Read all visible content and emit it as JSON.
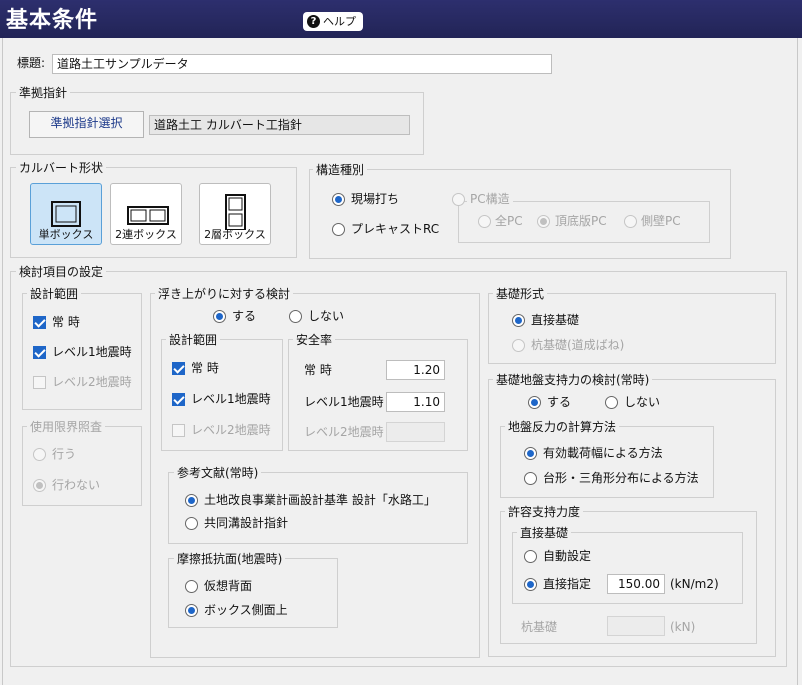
{
  "header": {
    "title": "基本条件",
    "help_label": "ヘルプ"
  },
  "title_field": {
    "label": "標題:",
    "value": "道路土工サンプルデータ"
  },
  "standard": {
    "legend": "準拠指針",
    "button_label": "準拠指針選択",
    "value": "道路土工 カルバート工指針"
  },
  "culvert_shape": {
    "legend": "カルバート形状",
    "options": [
      {
        "label": "単ボックス",
        "selected": true
      },
      {
        "label": "2連ボックス",
        "selected": false
      },
      {
        "label": "2層ボックス",
        "selected": false
      }
    ]
  },
  "structure_type": {
    "legend": "構造種別",
    "cast_in_place": "現場打ち",
    "precast": "プレキャストRC",
    "pc_legend": "PC構造",
    "pc_options": [
      "全PC",
      "頂底版PC",
      "側壁PC"
    ]
  },
  "check_items": {
    "legend": "検討項目の設定",
    "design_range": {
      "legend": "設計範囲",
      "items": [
        "常 時",
        "レベル1地震時",
        "レベル2地震時"
      ]
    },
    "service_limit": {
      "legend": "使用限界照査",
      "yes": "行う",
      "no": "行わない"
    }
  },
  "uplift": {
    "legend": "浮き上がりに対する検討",
    "yes": "する",
    "no": "しない",
    "design_range": {
      "legend": "設計範囲",
      "items": [
        "常 時",
        "レベル1地震時",
        "レベル2地震時"
      ]
    },
    "safety": {
      "legend": "安全率",
      "rows": [
        {
          "label": "常 時",
          "value": "1.20"
        },
        {
          "label": "レベル1地震時",
          "value": "1.10"
        },
        {
          "label": "レベル2地震時",
          "value": ""
        }
      ]
    },
    "reference": {
      "legend": "参考文献(常時)",
      "options": [
        "土地改良事業計画設計基準 設計「水路工」",
        "共同溝設計指針"
      ]
    },
    "friction": {
      "legend": "摩擦抵抗面(地震時)",
      "options": [
        "仮想背面",
        "ボックス側面上"
      ]
    }
  },
  "foundation": {
    "legend": "基礎形式",
    "direct": "直接基礎",
    "pile": "杭基礎(道成ばね)"
  },
  "bearing": {
    "legend": "基礎地盤支持力の検討(常時)",
    "yes": "する",
    "no": "しない",
    "method": {
      "legend": "地盤反力の計算方法",
      "options": [
        "有効載荷幅による方法",
        "台形・三角形分布による方法"
      ]
    },
    "allowable": {
      "legend": "許容支持力度",
      "direct": {
        "legend": "直接基礎",
        "auto": "自動設定",
        "manual": "直接指定",
        "value": "150.00",
        "unit": "(kN/m2)"
      },
      "pile": {
        "label": "杭基礎",
        "value": "",
        "unit": "(kN)"
      }
    }
  },
  "colors": {
    "accent": "#1e66c8",
    "title_bar": "#2d2f6e",
    "selected_bg": "#cce4f7"
  }
}
